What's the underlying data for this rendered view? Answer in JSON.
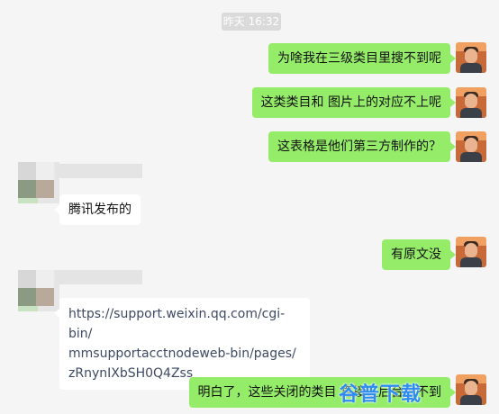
{
  "chat": {
    "timestamp": "昨天 16:32",
    "messages": [
      {
        "direction": "out",
        "text": "为啥我在三级类目里搜不到呢"
      },
      {
        "direction": "out",
        "text": "这类类目和 图片上的对应不上呢"
      },
      {
        "direction": "out",
        "text": "这表格是他们第三方制作的？"
      },
      {
        "direction": "in",
        "text": "腾讯发布的"
      },
      {
        "direction": "out",
        "text": "有原文没"
      },
      {
        "direction": "in",
        "text": "https://support.weixin.qq.com/cgi-bin/mmsupportacctnodeweb-bin/pages/zRnynIXbSH0Q4Zss",
        "lines": [
          "https://support.weixin.qq.com/cgi-bin/",
          "mmsupportacctnodeweb-bin/pages/",
          "zRnynIXbSH0Q4Zss"
        ]
      },
      {
        "direction": "out",
        "text": "明白了，这些关闭的类目 直接在后台搜不到"
      }
    ],
    "watermark": "谷普下载"
  },
  "colors": {
    "background": "#f5f5f5",
    "outgoing_bubble": "#95ec69",
    "incoming_bubble": "#ffffff",
    "timestamp_bg": "#dadada",
    "watermark": "#2d8cf0"
  },
  "icons": {
    "self_avatar": "user-avatar-photo",
    "contact_avatar": "blurred-contact-avatar"
  }
}
